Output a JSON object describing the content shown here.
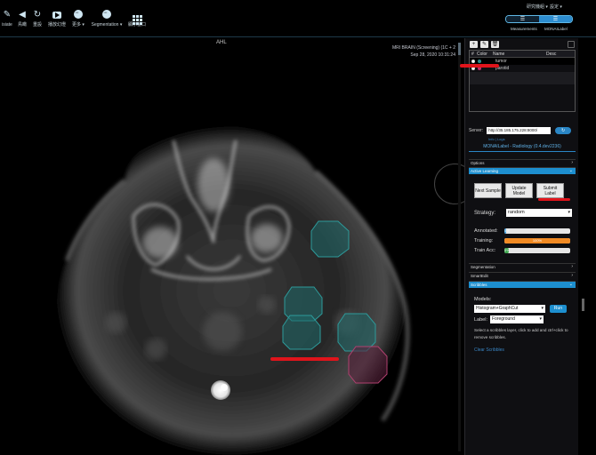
{
  "toolbar": {
    "tools": [
      {
        "label": "isiate",
        "icon": "pencil-icon"
      },
      {
        "label": "鳥瞰",
        "icon": "view-icon"
      },
      {
        "label": "重設",
        "icon": "reset-icon"
      },
      {
        "label": "播放幻燈",
        "icon": "play-video-icon"
      },
      {
        "label": "更多 ▾",
        "icon": "more-icon"
      },
      {
        "label": "Segmentation ▾",
        "icon": "segmentation-icon"
      },
      {
        "label": "顯示窗口",
        "icon": "layout-grid-icon"
      }
    ],
    "user_menu": "研究機組 ▾",
    "lang_menu": "設定 ▾",
    "panel_switch": {
      "left_label": "Measurements",
      "right_label": "MONAILabel"
    }
  },
  "viewport": {
    "orientation_top": "AHL",
    "scan_info": [
      "MRI BRAIN (Screening) (1C + 2",
      "Sep 28, 2020 10:31:24"
    ]
  },
  "panel": {
    "seg_tools": [
      "+",
      "✎",
      "🗑"
    ],
    "table": {
      "headers": {
        "num": "#",
        "color": "Color",
        "name": "Name",
        "desc": "Desc"
      },
      "rows": [
        {
          "name": "tumor",
          "color": "#2a8c8c"
        },
        {
          "name": "parotid",
          "color": "#c0306f"
        }
      ]
    },
    "server": {
      "label": "Server:",
      "url": "http://35.185.175.228:8000/",
      "go": "↻",
      "links": "Info | Logs"
    },
    "ml_title": "MONAILabel - Radiology (0.4.dev2236)",
    "sections": {
      "options": "Options",
      "active_learning": "Active Learning",
      "segmentation": "Segmentation",
      "smartedit": "SmartEdit",
      "scribbles": "Scribbles"
    },
    "al": {
      "next_sample": "Next Sample",
      "update_model": "Update Model",
      "submit_label": "Submit Label",
      "strategy_label": "Strategy:",
      "strategy_value": "random",
      "annotated_label": "Annotated:",
      "annotated_value": "0%",
      "annotated_pct": 3,
      "training_label": "Training:",
      "training_value": "100%",
      "training_pct": 100,
      "train_acc_label": "Train Acc:",
      "train_acc_value": "0%",
      "train_acc_pct": 7
    },
    "scribbles": {
      "models_label": "Models:",
      "model_value": "Histogram+GraphCut",
      "run_label": "Run",
      "label_label": "Label:",
      "label_value": "Foreground",
      "help_text": "Select a scribbles layer, click to add and ctrl+click to remove scribbles.",
      "clear_label": "Clear Scribbles"
    }
  },
  "colors": {
    "accent": "#1d8fcf",
    "training_bar": "#f08a24",
    "annotated_bar": "#3a9ad9",
    "acc_bar": "#39a54a",
    "annotation_red": "#e0141b"
  }
}
